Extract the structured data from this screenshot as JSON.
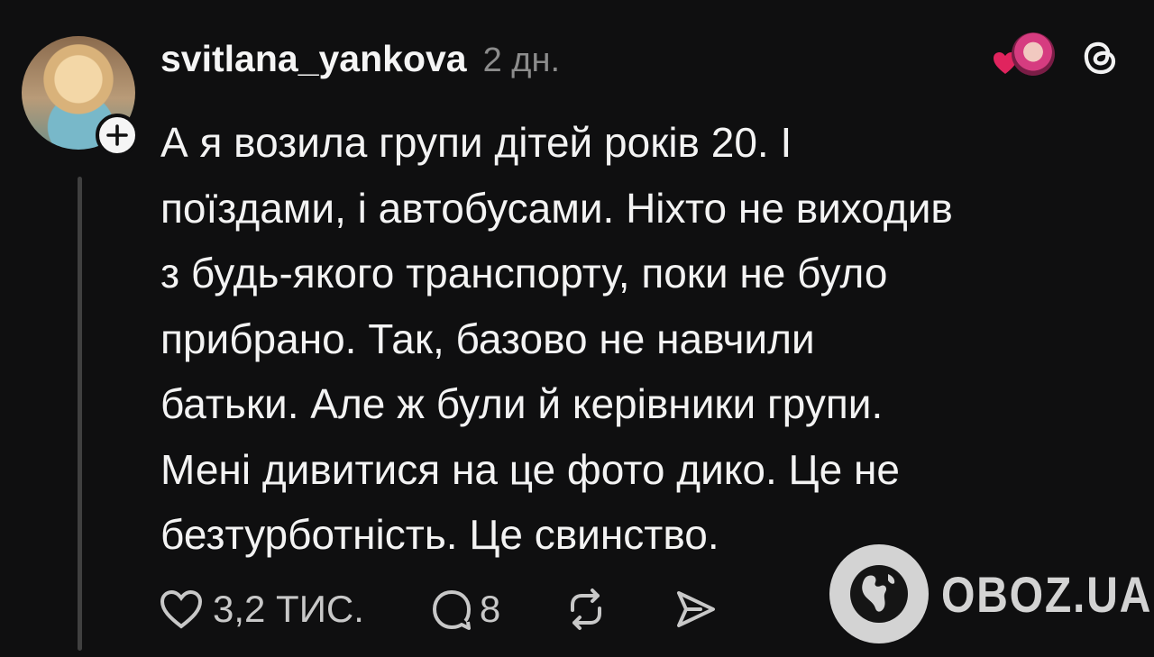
{
  "post": {
    "username": "svitlana_yankova",
    "time": "2 дн.",
    "text": "А я возила групи дітей років 20. І\nпоїздами, і автобусами. Ніхто не виходив\nз будь-якого транспорту, поки не було\nприбрано. Так, базово не навчили\nбатьки. Але ж були й керівники групи.\nМені дивитися на це фото дико. Це не\nбезтурботність. Це свинство."
  },
  "actions": {
    "likes": "3,2 ТИС.",
    "replies": "8"
  },
  "icons": {
    "follow": "plus-icon",
    "like": "heart-icon",
    "reply": "comment-icon",
    "repost": "repost-icon",
    "share": "send-icon",
    "app": "threads-logo-icon"
  },
  "watermark": {
    "text": "OBOZ.UA"
  },
  "colors": {
    "background": "#0f0f10",
    "text": "#f3f3f3",
    "muted": "#8c8c8c",
    "heart": "#e0245e"
  }
}
